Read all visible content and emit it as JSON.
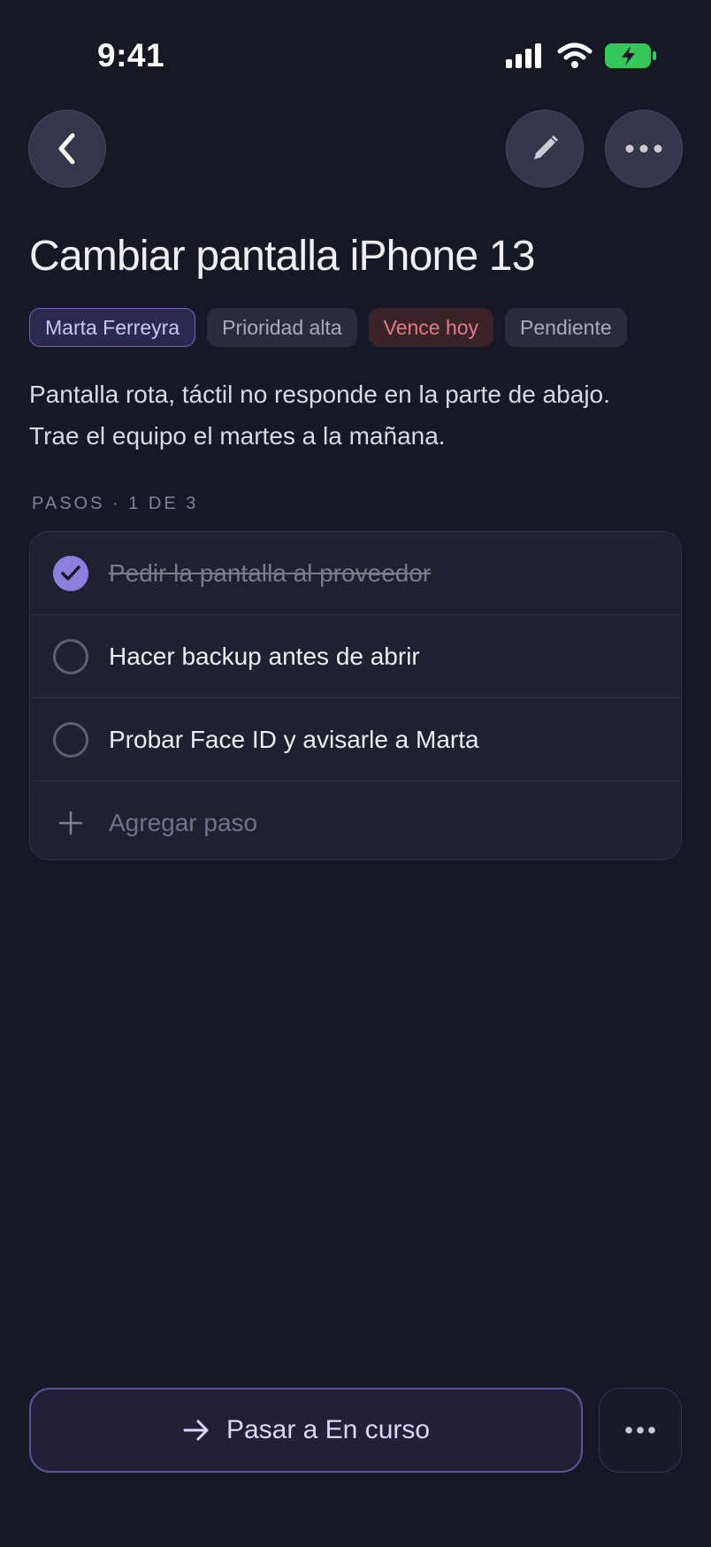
{
  "status_bar": {
    "time": "9:41"
  },
  "header": {
    "back_icon": "chevron-left-icon",
    "edit_icon": "pencil-icon",
    "more_icon": "ellipsis-icon"
  },
  "task": {
    "title": "Cambiar pantalla iPhone 13",
    "chips": {
      "assignee": "Marta Ferreyra",
      "priority": "Prioridad alta",
      "due": "Vence hoy",
      "status": "Pendiente"
    },
    "description_line1": "Pantalla rota, táctil no responde en la parte de abajo.",
    "description_line2": "Trae el equipo el martes a la mañana."
  },
  "steps": {
    "section_label": "PASOS · 1 DE 3",
    "items": [
      {
        "label": "Pedir la pantalla al proveedor",
        "done": true
      },
      {
        "label": "Hacer backup antes de abrir",
        "done": false
      },
      {
        "label": "Probar Face ID y avisarle a Marta",
        "done": false
      }
    ],
    "add_label": "Agregar paso"
  },
  "footer": {
    "primary_label": "Pasar a En curso",
    "primary_icon": "arrow-right-icon",
    "secondary_icon": "ellipsis-icon"
  },
  "colors": {
    "background": "#171826",
    "accent": "#8e7fde",
    "due_red": "#e07d80",
    "battery_green": "#34c759"
  }
}
